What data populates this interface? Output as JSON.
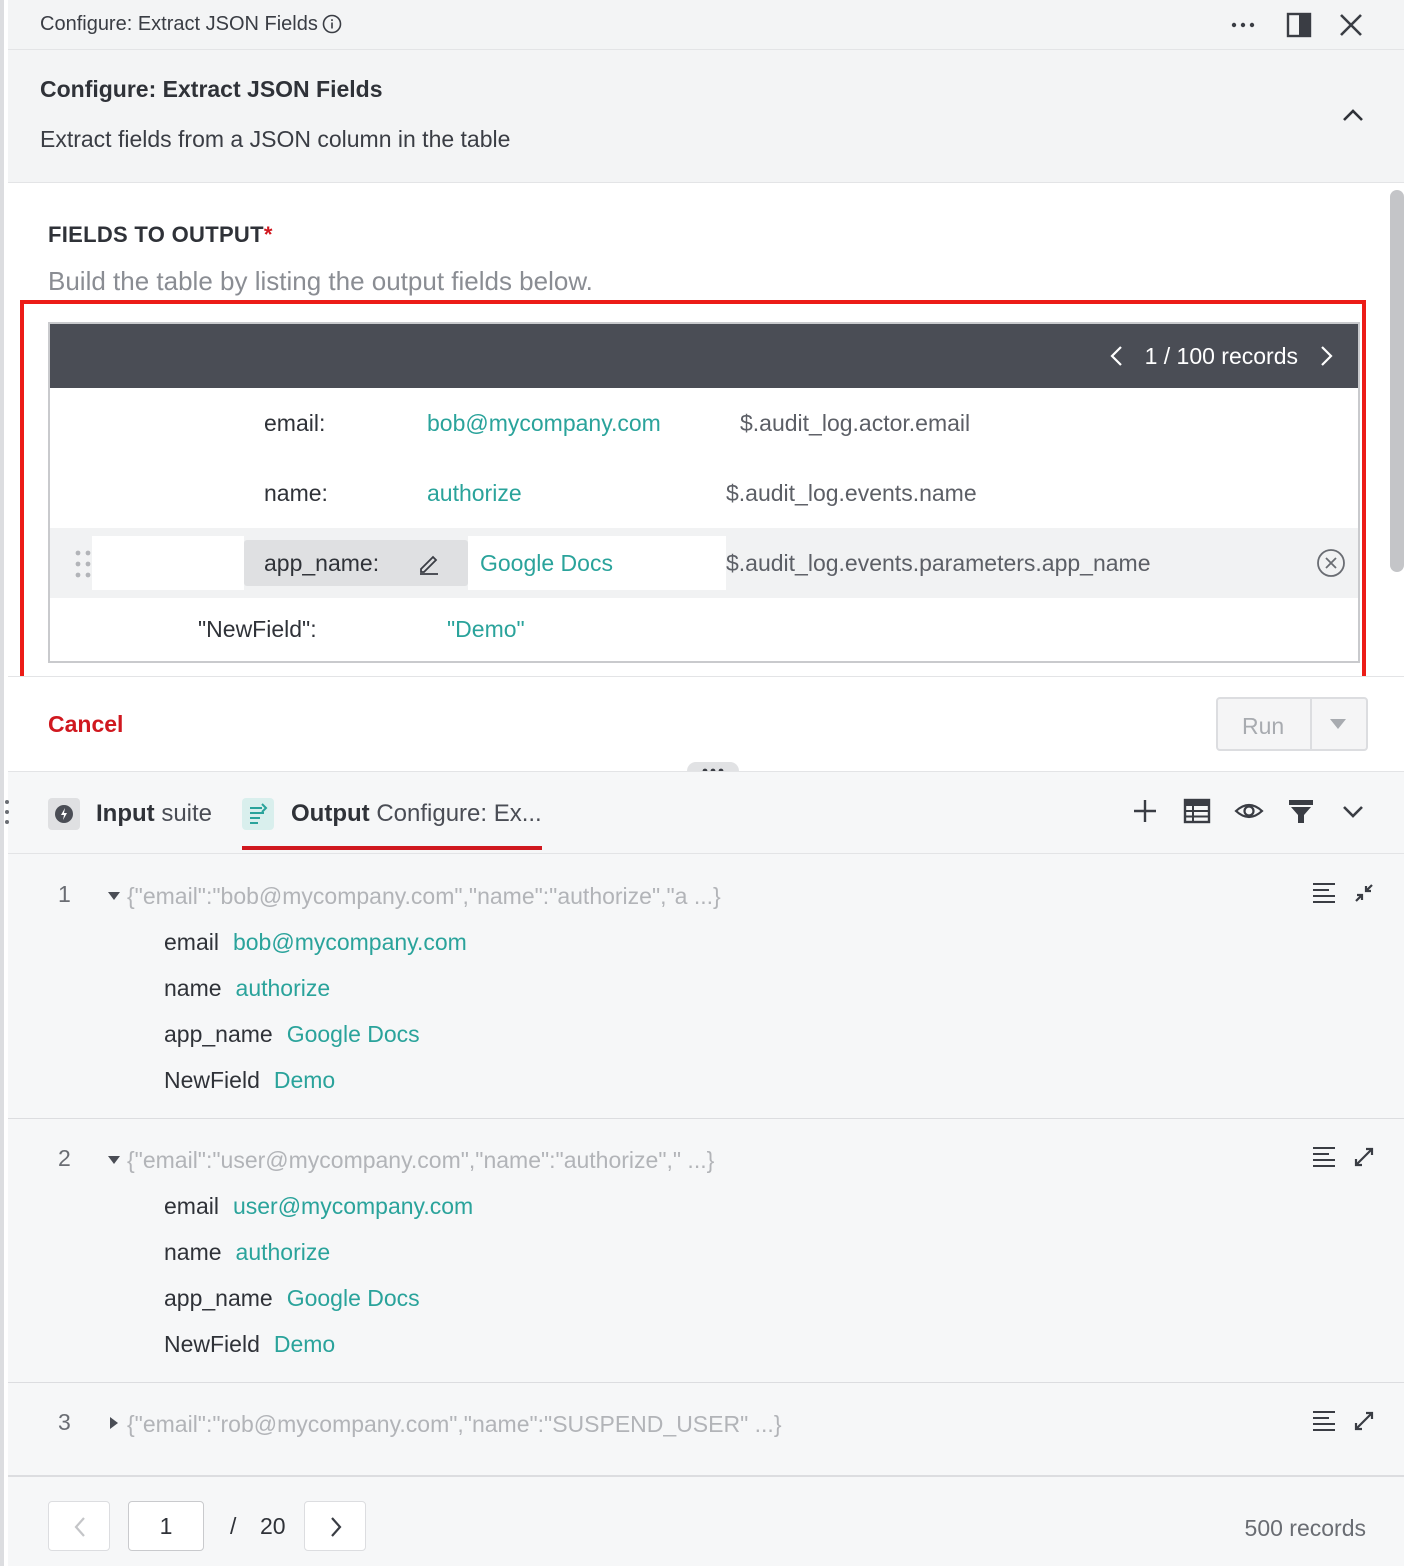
{
  "window": {
    "title": "Configure: Extract JSON Fields"
  },
  "header": {
    "title": "Configure: Extract JSON Fields",
    "subtitle": "Extract fields from a JSON column in the table"
  },
  "config": {
    "fields_label": "FIELDS TO OUTPUT",
    "required_mark": "*",
    "hint": "Build the table by listing the output fields below.",
    "records_nav": "1 / 100 records",
    "fields": [
      {
        "key": "email:",
        "value": "bob@mycompany.com",
        "path": "$.audit_log.actor.email"
      },
      {
        "key": "name:",
        "value": "authorize",
        "path": "$.audit_log.events.name"
      },
      {
        "key": "app_name:",
        "value": "Google Docs",
        "path": "$.audit_log.events.parameters.app_name"
      },
      {
        "key": "\"NewField\":",
        "value": "\"Demo\"",
        "path": ""
      }
    ],
    "cancel_label": "Cancel",
    "run_label": "Run"
  },
  "output": {
    "tabs": [
      {
        "bold": "Input",
        "rest": "suite"
      },
      {
        "bold": "Output",
        "rest": "Configure: Ex..."
      }
    ],
    "records": [
      {
        "num": "1",
        "json": "{\"email\":\"bob@mycompany.com\",\"name\":\"authorize\",\"a ...}",
        "expanded": true,
        "fields": [
          {
            "k": "email",
            "v": "bob@mycompany.com"
          },
          {
            "k": "name",
            "v": "authorize"
          },
          {
            "k": "app_name",
            "v": "Google Docs"
          },
          {
            "k": "NewField",
            "v": "Demo"
          }
        ]
      },
      {
        "num": "2",
        "json": "{\"email\":\"user@mycompany.com\",\"name\":\"authorize\",\" ...}",
        "expanded": true,
        "fields": [
          {
            "k": "email",
            "v": "user@mycompany.com"
          },
          {
            "k": "name",
            "v": "authorize"
          },
          {
            "k": "app_name",
            "v": "Google Docs"
          },
          {
            "k": "NewField",
            "v": "Demo"
          }
        ]
      },
      {
        "num": "3",
        "json": "{\"email\":\"rob@mycompany.com\",\"name\":\"SUSPEND_USER\" ...}",
        "expanded": false,
        "fields": []
      }
    ],
    "pager": {
      "page": "1",
      "slash": "/",
      "total_pages": "20",
      "record_count": "500 records"
    }
  },
  "colors": {
    "accent_red": "#d0181f",
    "value_teal": "#2aa39b",
    "highlight_red": "#ec1c17",
    "builder_header": "#4a4d55"
  },
  "icons": [
    "info-icon",
    "more-icon",
    "split-view-icon",
    "close-icon",
    "chevron-up-icon",
    "chevron-left-icon",
    "chevron-right-icon",
    "drag-handle-icon",
    "pencil-icon",
    "remove-circle-icon",
    "caret-down-icon",
    "suite-icon",
    "output-icon",
    "plus-icon",
    "table-icon",
    "eye-icon",
    "filter-icon",
    "chevron-down-icon",
    "wrap-icon",
    "expand-icon",
    "collapse-icon",
    "triangle-down-icon",
    "triangle-right-icon"
  ]
}
